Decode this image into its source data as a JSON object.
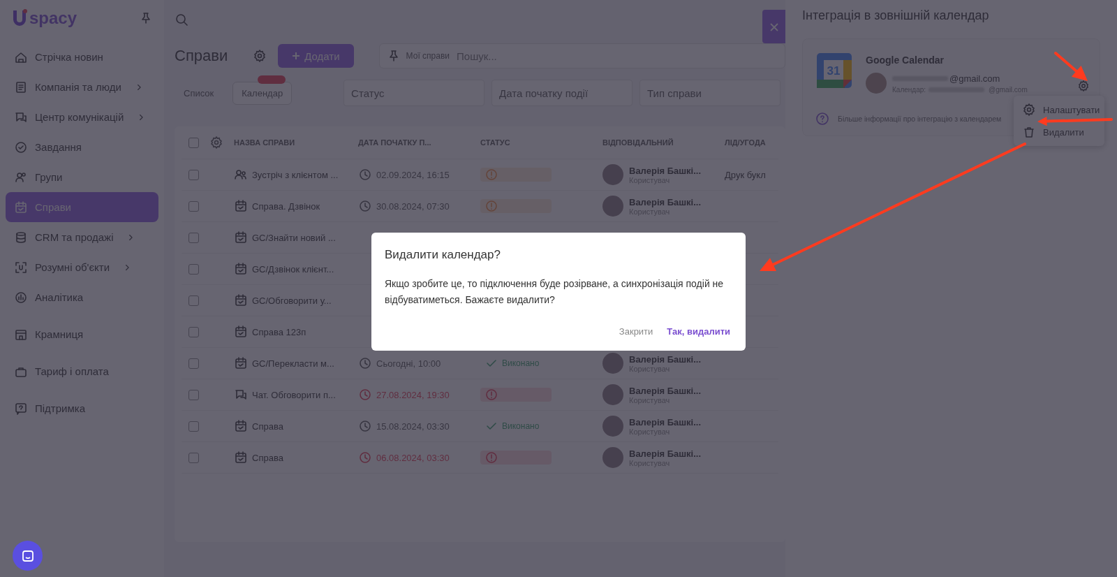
{
  "sidebar": {
    "logo": "spacy",
    "sections": [
      [
        {
          "label": "Стрічка новин",
          "expandable": false,
          "selected": false
        },
        {
          "label": "Компанія та люди",
          "expandable": true,
          "selected": false
        },
        {
          "label": "Центр комунікацій",
          "expandable": true,
          "selected": false
        },
        {
          "label": "Завдання",
          "expandable": false,
          "selected": false
        },
        {
          "label": "Групи",
          "expandable": false,
          "selected": false
        },
        {
          "label": "Справи",
          "expandable": false,
          "selected": true
        },
        {
          "label": "CRM та продажі",
          "expandable": true,
          "selected": false
        },
        {
          "label": "Розумні об'єкти",
          "expandable": true,
          "selected": false
        },
        {
          "label": "Аналітика",
          "expandable": false,
          "selected": false
        }
      ],
      [
        {
          "label": "Крамниця",
          "expandable": false,
          "selected": false
        }
      ],
      [
        {
          "label": "Тариф і оплата",
          "expandable": false,
          "selected": false
        }
      ],
      [
        {
          "label": "Підтримка",
          "expandable": false,
          "selected": false
        }
      ]
    ]
  },
  "main": {
    "title": "Справи",
    "add_button": "Додати",
    "search": {
      "chip": "Мої справи",
      "placeholder": "Пошук..."
    },
    "view_tabs": [
      {
        "label": "Список",
        "selected": false
      },
      {
        "label": "Календар",
        "selected": true
      }
    ],
    "filters": [
      "Статус",
      "Дата початку події",
      "Тип справи"
    ],
    "table": {
      "header_checked": false,
      "columns": [
        "НАЗВА СПРАВИ",
        "ДАТА ПОЧАТКУ П...",
        "СТАТУС",
        "ВІДПОВІДАЛЬНИЙ",
        "ЛІД/УГОДА"
      ],
      "rows": [
        {
          "checked": false,
          "name": "Зустріч з клієнтом ...",
          "kind": "meeting",
          "date": "02.09.2024, 16:15",
          "overdue": false,
          "status": {
            "kind": "planned"
          },
          "assignee": "Валерія Башкі...",
          "role": "Користувач",
          "deal": "Друк букл"
        },
        {
          "checked": false,
          "name": "Справа. Дзвінок",
          "kind": "task",
          "date": "30.08.2024, 07:30",
          "overdue": false,
          "status": {
            "kind": "planned"
          },
          "assignee": "Валерія Башкі...",
          "role": "Користувач"
        },
        {
          "checked": false,
          "name": "GC/Знайти новий ...",
          "kind": "task"
        },
        {
          "checked": false,
          "name": "GC/Дзвінок клієнт...",
          "kind": "task"
        },
        {
          "checked": false,
          "name": "GC/Обговорити у...",
          "kind": "task"
        },
        {
          "checked": false,
          "name": "Справа 123п",
          "kind": "task"
        },
        {
          "checked": false,
          "name": "GC/Перекласти м...",
          "kind": "task",
          "date": "Сьогодні, 10:00",
          "overdue": false,
          "status": {
            "kind": "done",
            "label": "Виконано"
          },
          "assignee": "Валерія Башкі...",
          "role": "Користувач"
        },
        {
          "checked": false,
          "name": "Чат. Обговорити п...",
          "kind": "chat",
          "date": "27.08.2024, 19:30",
          "overdue": true,
          "status": {
            "kind": "overdue"
          },
          "assignee": "Валерія Башкі...",
          "role": "Користувач"
        },
        {
          "checked": false,
          "name": "Справа",
          "kind": "task",
          "date": "15.08.2024, 03:30",
          "overdue": false,
          "status": {
            "kind": "done",
            "label": "Виконано"
          },
          "assignee": "Валерія Башкі...",
          "role": "Користувач"
        },
        {
          "checked": false,
          "name": "Справа",
          "kind": "task",
          "date": "06.08.2024, 03:30",
          "overdue": true,
          "status": {
            "kind": "overdue"
          },
          "assignee": "Валерія Башкі...",
          "role": "Користувач"
        }
      ]
    }
  },
  "panel": {
    "title": "Інтеграція в зовнішній календар",
    "card": {
      "service": "Google Calendar",
      "calendar_icon_text": "31",
      "email": "@gmail.com",
      "calendar_label": "Календар:",
      "calendar_email": "@gmail.com"
    },
    "menu": [
      "Налаштувати",
      "Видалити"
    ],
    "info_link": "Більше інформації про інтеграцію з календарем"
  },
  "dialog": {
    "title": "Видалити календар?",
    "text": "Якщо зробите це, то підключення буде розірване, а синхронізація подій не відбуватиметься. Бажаєте видалити?",
    "buttons": [
      {
        "label": "Закрити",
        "kind": "secondary"
      },
      {
        "label": "Так, видалити",
        "kind": "primary"
      }
    ]
  }
}
